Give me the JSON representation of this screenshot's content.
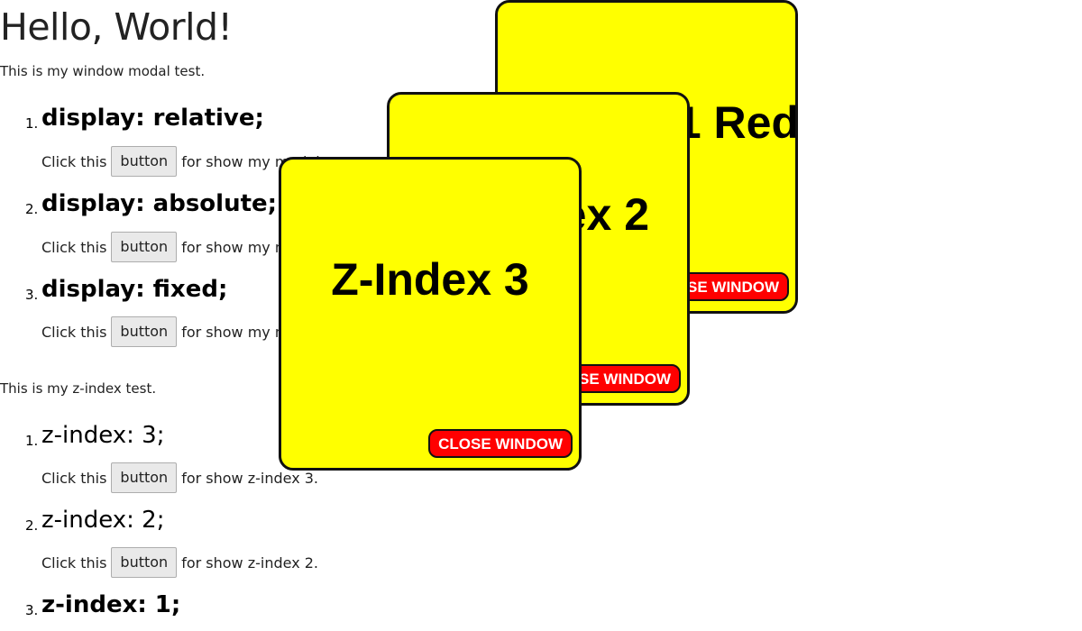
{
  "heading": "Hello, World!",
  "modal_section": {
    "intro": "This is my window modal test.",
    "items": [
      {
        "num": "1.",
        "title": "display: relative;",
        "prefix": "Click this",
        "button": "button",
        "suffix": "for show my modal."
      },
      {
        "num": "2.",
        "title": "display: absolute;",
        "prefix": "Click this",
        "button": "button",
        "suffix": "for show my modal."
      },
      {
        "num": "3.",
        "title": "display: fixed;",
        "prefix": "Click this",
        "button": "button",
        "suffix": "for show my modal."
      }
    ]
  },
  "zindex_section": {
    "intro": "This is my z-index test.",
    "items": [
      {
        "num": "1.",
        "title": "z-index: 3;",
        "prefix": "Click this",
        "button": "button",
        "suffix": "for show z-index 3."
      },
      {
        "num": "2.",
        "title": "z-index: 2;",
        "prefix": "Click this",
        "button": "button",
        "suffix": "for show z-index 2."
      },
      {
        "num": "3.",
        "title": "z-index: 1;"
      }
    ]
  },
  "modals": [
    {
      "title": "Z-Index 1 Red",
      "close": "CLOSE WINDOW"
    },
    {
      "title": "Z-Index 2",
      "close": "CLOSE WINDOW"
    },
    {
      "title": "Z-Index 3",
      "close": "CLOSE WINDOW"
    }
  ],
  "colors": {
    "modal_bg": "#ffff00",
    "close_bg": "#ff0000",
    "close_text": "#ffffff"
  }
}
